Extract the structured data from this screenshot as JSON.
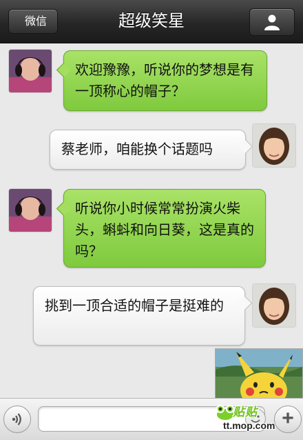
{
  "header": {
    "back_label": "微信",
    "title": "超级笑星",
    "profile_icon": "person-icon"
  },
  "messages": [
    {
      "sender": "host",
      "style": "green",
      "text": "欢迎豫豫，听说你的梦想是有一顶称心的帽子？"
    },
    {
      "sender": "guest",
      "style": "white",
      "text": "蔡老师，咱能换个话题吗"
    },
    {
      "sender": "host",
      "style": "green",
      "text": "听说你小时候常常扮演火柴头，蝌蚪和向日葵，这是真的吗？"
    },
    {
      "sender": "guest",
      "style": "white",
      "text": "挑到一顶合适的帽子是挺难的"
    }
  ],
  "input": {
    "placeholder": "",
    "value": ""
  },
  "watermark": {
    "top_text": "贴贴",
    "bottom_text": "tt.mop.com"
  },
  "colors": {
    "header_bg": "#262626",
    "green_bubble": "#8fd24b",
    "white_bubble": "#f6f6f6",
    "chat_bg": "#e9e9e9"
  }
}
